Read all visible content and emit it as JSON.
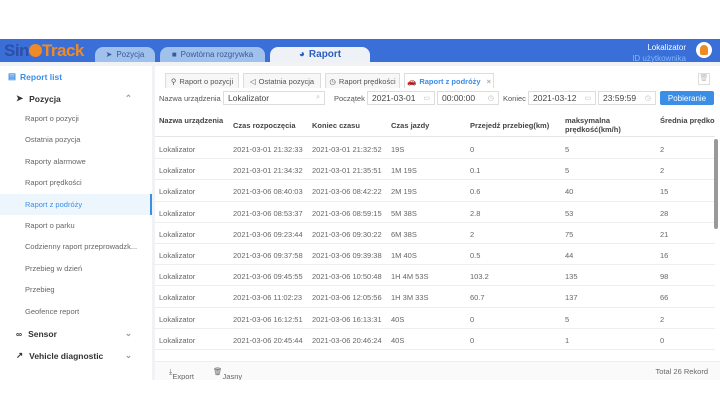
{
  "header": {
    "logo": "SinoTrack",
    "tabs": [
      {
        "label": "Pozycja",
        "icon": "send-icon"
      },
      {
        "label": "Powtórna rozgrywka",
        "icon": "video-icon"
      },
      {
        "label": "Raport",
        "icon": "pie-chart-icon"
      }
    ],
    "user_name": "Lokalizator",
    "user_id": "ID użytkownika"
  },
  "sidebar": {
    "title": "Report list",
    "group": "Pozycja",
    "items": [
      "Raport o pozycji",
      "Ostatnia pozycja",
      "Raporty alarmowe",
      "Raport prędkości",
      "Raport z podróży",
      "Raport o parku",
      "Codzienny raport przeprowadzk...",
      "Przebieg w dzień",
      "Przebieg",
      "Geofence report"
    ],
    "active": "Raport z podróży",
    "sensor": "Sensor",
    "vehicle": "Vehicle diagnostic"
  },
  "report_tabs": [
    "Raport o pozycji",
    "Ostatnia pozycja",
    "Raport prędkości",
    "Raport z podróży"
  ],
  "filters": {
    "device_label": "Nazwa urządzenia",
    "device_value": "Lokalizator",
    "start_label": "Początek",
    "start_date": "2021-03-01",
    "start_time": "00:00:00",
    "end_label": "Koniec",
    "end_date": "2021-03-12",
    "end_time": "23:59:59",
    "submit": "Pobieranie"
  },
  "table": {
    "columns": [
      "Nazwa urządzenia",
      "Czas rozpoczęcia",
      "Koniec czasu",
      "Czas jazdy",
      "Przejedź przebieg(km)",
      "maksymalna prędkość(km/h)",
      "Średnia prędkość"
    ],
    "rows": [
      [
        "Lokalizator",
        "2021-03-01 21:32:33",
        "2021-03-01 21:32:52",
        "19S",
        "0",
        "5",
        "2"
      ],
      [
        "Lokalizator",
        "2021-03-01 21:34:32",
        "2021-03-01 21:35:51",
        "1M 19S",
        "0.1",
        "5",
        "2"
      ],
      [
        "Lokalizator",
        "2021-03-06 08:40:03",
        "2021-03-06 08:42:22",
        "2M 19S",
        "0.6",
        "40",
        "15"
      ],
      [
        "Lokalizator",
        "2021-03-06 08:53:37",
        "2021-03-06 08:59:15",
        "5M 38S",
        "2.8",
        "53",
        "28"
      ],
      [
        "Lokalizator",
        "2021-03-06 09:23:44",
        "2021-03-06 09:30:22",
        "6M 38S",
        "2",
        "75",
        "21"
      ],
      [
        "Lokalizator",
        "2021-03-06 09:37:58",
        "2021-03-06 09:39:38",
        "1M 40S",
        "0.5",
        "44",
        "16"
      ],
      [
        "Lokalizator",
        "2021-03-06 09:45:55",
        "2021-03-06 10:50:48",
        "1H 4M 53S",
        "103.2",
        "135",
        "98"
      ],
      [
        "Lokalizator",
        "2021-03-06 11:02:23",
        "2021-03-06 12:05:56",
        "1H 3M 33S",
        "60.7",
        "137",
        "66"
      ],
      [
        "Lokalizator",
        "2021-03-06 16:12:51",
        "2021-03-06 16:13:31",
        "40S",
        "0",
        "5",
        "2"
      ],
      [
        "Lokalizator",
        "2021-03-06 20:45:44",
        "2021-03-06 20:46:24",
        "40S",
        "0",
        "1",
        "0"
      ]
    ]
  },
  "footer": {
    "export": "Export",
    "clear": "Jasny",
    "total": "Total 26 Rekord"
  }
}
